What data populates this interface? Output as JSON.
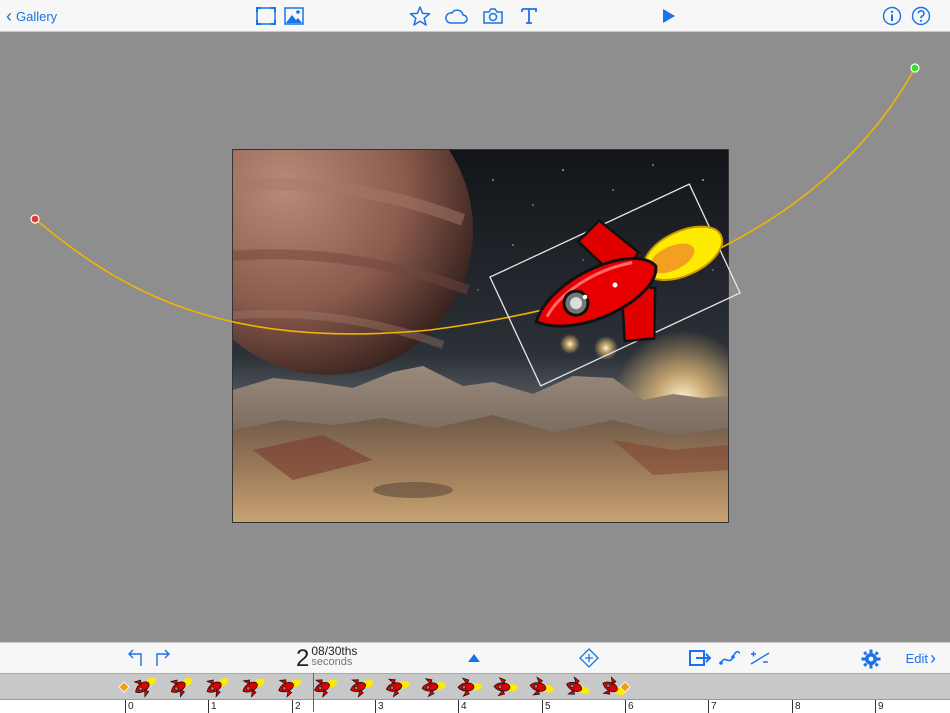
{
  "toolbar": {
    "back_label": "Gallery"
  },
  "icons": {
    "back": "chevron-left-icon",
    "frame": "frame-icon",
    "image": "image-icon",
    "star": "star-icon",
    "cloud": "cloud-icon",
    "camera": "camera-icon",
    "text": "text-icon",
    "play": "play-icon",
    "info": "info-icon",
    "help": "help-icon"
  },
  "timebar": {
    "seconds": "2",
    "fraction": "08/30ths",
    "unit": "seconds",
    "edit_label": "Edit"
  },
  "ruler": {
    "ticks": [
      "0",
      "1",
      "2",
      "3",
      "4",
      "5",
      "6",
      "7",
      "8",
      "9"
    ]
  },
  "colors": {
    "accent": "#1a73e8",
    "path": "#f0b400",
    "start_point": "#e53935",
    "end_point": "#2ee62e",
    "playhead": "#e03030",
    "keyframe": "#f39c12"
  }
}
